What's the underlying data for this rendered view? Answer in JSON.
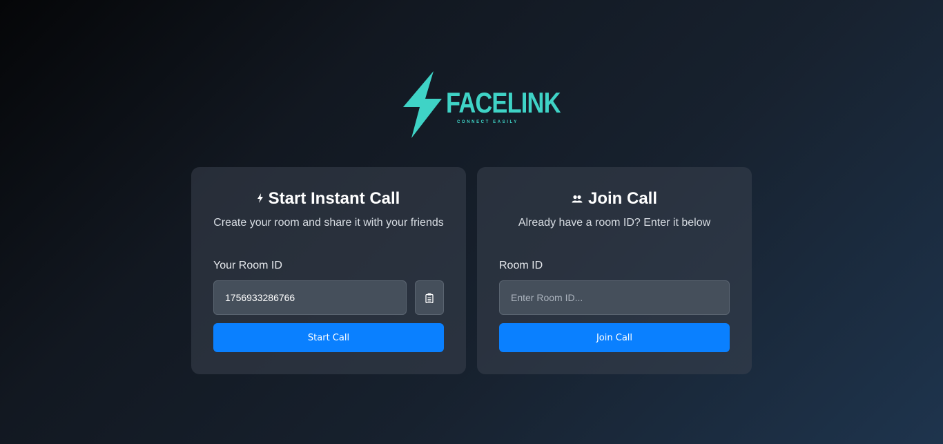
{
  "brand": {
    "name": "FACELINK",
    "tagline": "CONNECT EASILY",
    "color": "#3fd3c6",
    "icon": "lightning-bolt-icon"
  },
  "start_card": {
    "icon": "lightning-icon",
    "title": "Start Instant Call",
    "subtitle": "Create your room and share it with your friends",
    "field_label": "Your Room ID",
    "room_id_value": "1756933286766",
    "copy_icon": "clipboard-icon",
    "button_label": "Start Call"
  },
  "join_card": {
    "icon": "users-icon",
    "title": "Join Call",
    "subtitle": "Already have a room ID? Enter it below",
    "field_label": "Room ID",
    "room_id_value": "",
    "room_id_placeholder": "Enter Room ID...",
    "button_label": "Join Call"
  },
  "colors": {
    "primary_button": "#0a80ff",
    "card_background": "#323a45"
  }
}
